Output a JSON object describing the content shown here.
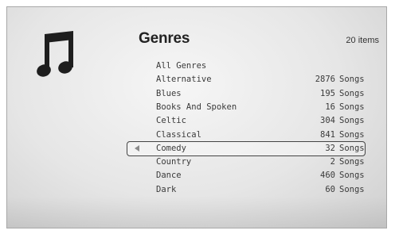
{
  "header": {
    "title": "Genres",
    "count": "20 items"
  },
  "icon": "music-note-icon",
  "genres": [
    {
      "name": "All Genres",
      "count": "",
      "unit": ""
    },
    {
      "name": "Alternative",
      "count": "2876",
      "unit": "Songs"
    },
    {
      "name": "Blues",
      "count": "195",
      "unit": "Songs"
    },
    {
      "name": "Books And Spoken",
      "count": "16",
      "unit": "Songs"
    },
    {
      "name": "Celtic",
      "count": "304",
      "unit": "Songs"
    },
    {
      "name": "Classical",
      "count": "841",
      "unit": "Songs"
    },
    {
      "name": "Comedy",
      "count": "32",
      "unit": "Songs",
      "selected": true
    },
    {
      "name": "Country",
      "count": "2",
      "unit": "Songs"
    },
    {
      "name": "Dance",
      "count": "460",
      "unit": "Songs"
    },
    {
      "name": "Dark",
      "count": "60",
      "unit": "Songs"
    }
  ]
}
